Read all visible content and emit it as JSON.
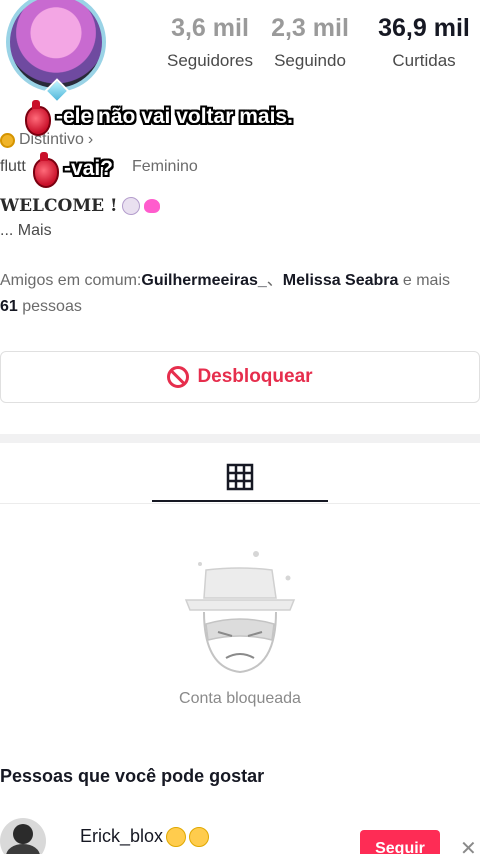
{
  "profile": {
    "stats": [
      {
        "value": "3,6 mil",
        "label": "Seguidores"
      },
      {
        "value": "2,3 mil",
        "label": "Seguindo"
      },
      {
        "value": "36,9 mil",
        "label": "Curtidas"
      }
    ],
    "badge_label": "Distintivo",
    "badge_chevron": "›",
    "username_partial": "flutt",
    "gender": "Feminino",
    "bio": "WELCOME !",
    "bio_more_prefix": "...",
    "bio_more": "Mais",
    "mutual_prefix": "Amigos em comum:",
    "mutual_friend_1": "Guilhermeeiras_",
    "mutual_separator": "、",
    "mutual_friend_2": "Melissa Seabra",
    "mutual_middle": " e mais ",
    "mutual_count": "61",
    "mutual_suffix": " pessoas"
  },
  "overlays": {
    "caption_1": "-ele não vai voltar mais.",
    "caption_2": "-vai?"
  },
  "actions": {
    "unblock_label": "Desbloquear"
  },
  "content": {
    "blocked_text": "Conta bloqueada"
  },
  "suggestions": {
    "title": "Pessoas que você pode gostar",
    "items": [
      {
        "name": "Erick_blox",
        "follow_label": "Seguir",
        "dismiss": "✕"
      }
    ]
  },
  "colors": {
    "accent": "#e62e4d",
    "follow": "#fe2c55"
  }
}
